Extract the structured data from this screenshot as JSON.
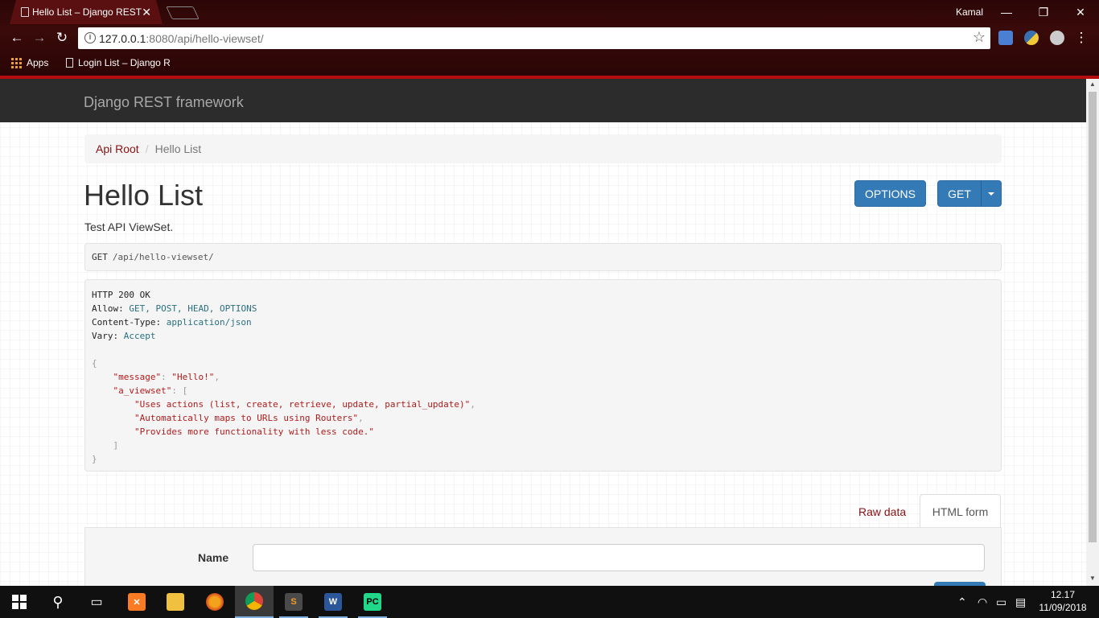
{
  "browser": {
    "tab_title": "Hello List – Django REST",
    "tab_close": "✕",
    "profile_name": "Kamal",
    "window_controls": {
      "minimize": "—",
      "restore": "❐",
      "close": "✕"
    },
    "url_host": "127.0.0.1",
    "url_rest": ":8080/api/hello-viewset/",
    "bookmarks": {
      "apps_label": "Apps",
      "item_1": "Login List – Django R"
    }
  },
  "site": {
    "brand": "Django REST framework",
    "breadcrumb": {
      "root": "Api Root",
      "separator": "/",
      "current": "Hello List"
    },
    "title": "Hello List",
    "description": "Test API ViewSet.",
    "buttons": {
      "options": "OPTIONS",
      "get": "GET"
    },
    "request": {
      "method": "GET",
      "path": "/api/hello-viewset/"
    },
    "response": {
      "status": "HTTP 200 OK",
      "headers": [
        {
          "key": "Allow:",
          "value": "GET, POST, HEAD, OPTIONS"
        },
        {
          "key": "Content-Type:",
          "value": "application/json"
        },
        {
          "key": "Vary:",
          "value": "Accept"
        }
      ],
      "json": {
        "open_brace": "{",
        "message_key": "\"message\"",
        "message_value": "\"Hello!\"",
        "viewset_key": "\"a_viewset\"",
        "open_bracket": "[",
        "items": [
          "\"Uses actions (list, create, retrieve, update, partial_update)\"",
          "\"Automatically maps to URLs using Routers\"",
          "\"Provides more functionality with less code.\""
        ],
        "close_bracket": "]",
        "close_brace": "}"
      }
    },
    "form_tabs": {
      "raw": "Raw data",
      "html": "HTML form"
    },
    "form": {
      "name_label": "Name",
      "name_value": ""
    }
  },
  "taskbar": {
    "time": "12.17",
    "date": "11/09/2018"
  },
  "colors": {
    "chrome_accent": "#b50d0d",
    "link": "#8b1010",
    "primary_button": "#337ab7",
    "navbar": "#2c2c2c"
  }
}
